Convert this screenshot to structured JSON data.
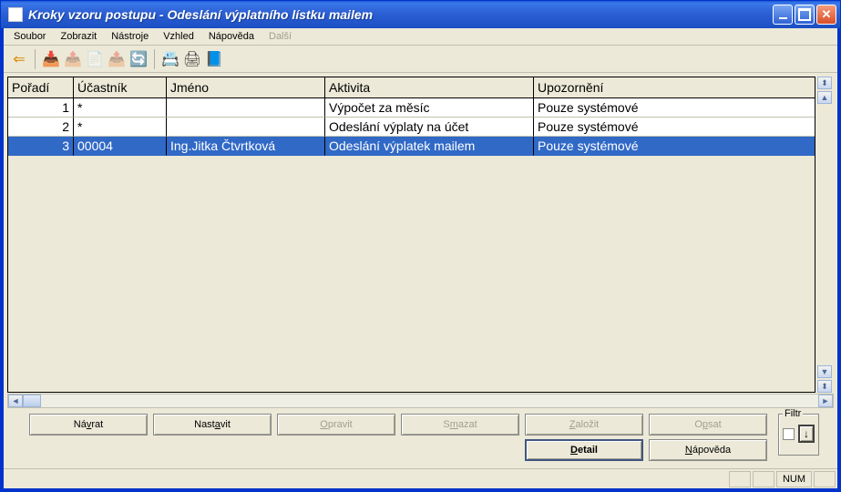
{
  "window": {
    "title": "Kroky vzoru postupu - Odeslání výplatního lístku mailem"
  },
  "menu": {
    "items": [
      "Soubor",
      "Zobrazit",
      "Nástroje",
      "Vzhled",
      "Nápověda",
      "Další"
    ],
    "disabled_index": 5
  },
  "toolbar": {
    "icons": [
      {
        "name": "back-arrow-icon",
        "glyph": "⇐",
        "color": "#d88a00"
      },
      {
        "sep": true
      },
      {
        "name": "doc-in-icon",
        "glyph": "📥",
        "color": "#2a6ac2"
      },
      {
        "name": "doc-out-icon",
        "glyph": "📤",
        "disabled": true
      },
      {
        "name": "page-icon",
        "glyph": "📄",
        "disabled": true
      },
      {
        "name": "page-out-icon",
        "glyph": "📤",
        "disabled": true
      },
      {
        "name": "refresh-icon",
        "glyph": "🔄",
        "color": "#2a6ac2"
      },
      {
        "sep": true
      },
      {
        "name": "calc-icon",
        "glyph": "📇",
        "color": "#2a6ac2"
      },
      {
        "name": "print-icon",
        "glyph": "🖨",
        "color": "#444"
      },
      {
        "name": "book-icon",
        "glyph": "📘",
        "color": "#2a6ac2"
      }
    ]
  },
  "grid": {
    "columns": {
      "poradi": "Pořadí",
      "ucastnik": "Účastník",
      "jmeno": "Jméno",
      "aktivita": "Aktivita",
      "upozorneni": "Upozornění"
    },
    "rows": [
      {
        "poradi": "1",
        "ucastnik": "*",
        "jmeno": "",
        "aktivita": "Výpočet za měsíc",
        "upozorneni": "Pouze systémové",
        "selected": false
      },
      {
        "poradi": "2",
        "ucastnik": "*",
        "jmeno": "",
        "aktivita": "Odeslání výplaty na účet",
        "upozorneni": "Pouze systémové",
        "selected": false
      },
      {
        "poradi": "3",
        "ucastnik": "00004",
        "jmeno": "Ing.Jitka Čtvrtková",
        "aktivita": "Odeslání výplatek mailem",
        "upozorneni": "Pouze systémové",
        "selected": true
      }
    ]
  },
  "buttons": {
    "navrat": {
      "pre": "Ná",
      "u": "v",
      "post": "rat",
      "disabled": false
    },
    "nastavit": {
      "pre": "Nast",
      "u": "a",
      "post": "vit",
      "disabled": false
    },
    "opravit": {
      "pre": "",
      "u": "O",
      "post": "pravit",
      "disabled": true
    },
    "smazat": {
      "pre": "S",
      "u": "m",
      "post": "azat",
      "disabled": true
    },
    "zalozit": {
      "pre": "",
      "u": "Z",
      "post": "aložit",
      "disabled": true
    },
    "opsat": {
      "pre": "O",
      "u": "p",
      "post": "sat",
      "disabled": true
    },
    "detail": {
      "pre": "",
      "u": "D",
      "post": "etail",
      "disabled": false
    },
    "napoveda": {
      "pre": "",
      "u": "N",
      "post": "ápověda",
      "disabled": false
    }
  },
  "filter": {
    "label": "Filtr"
  },
  "status": {
    "num": "NUM"
  }
}
